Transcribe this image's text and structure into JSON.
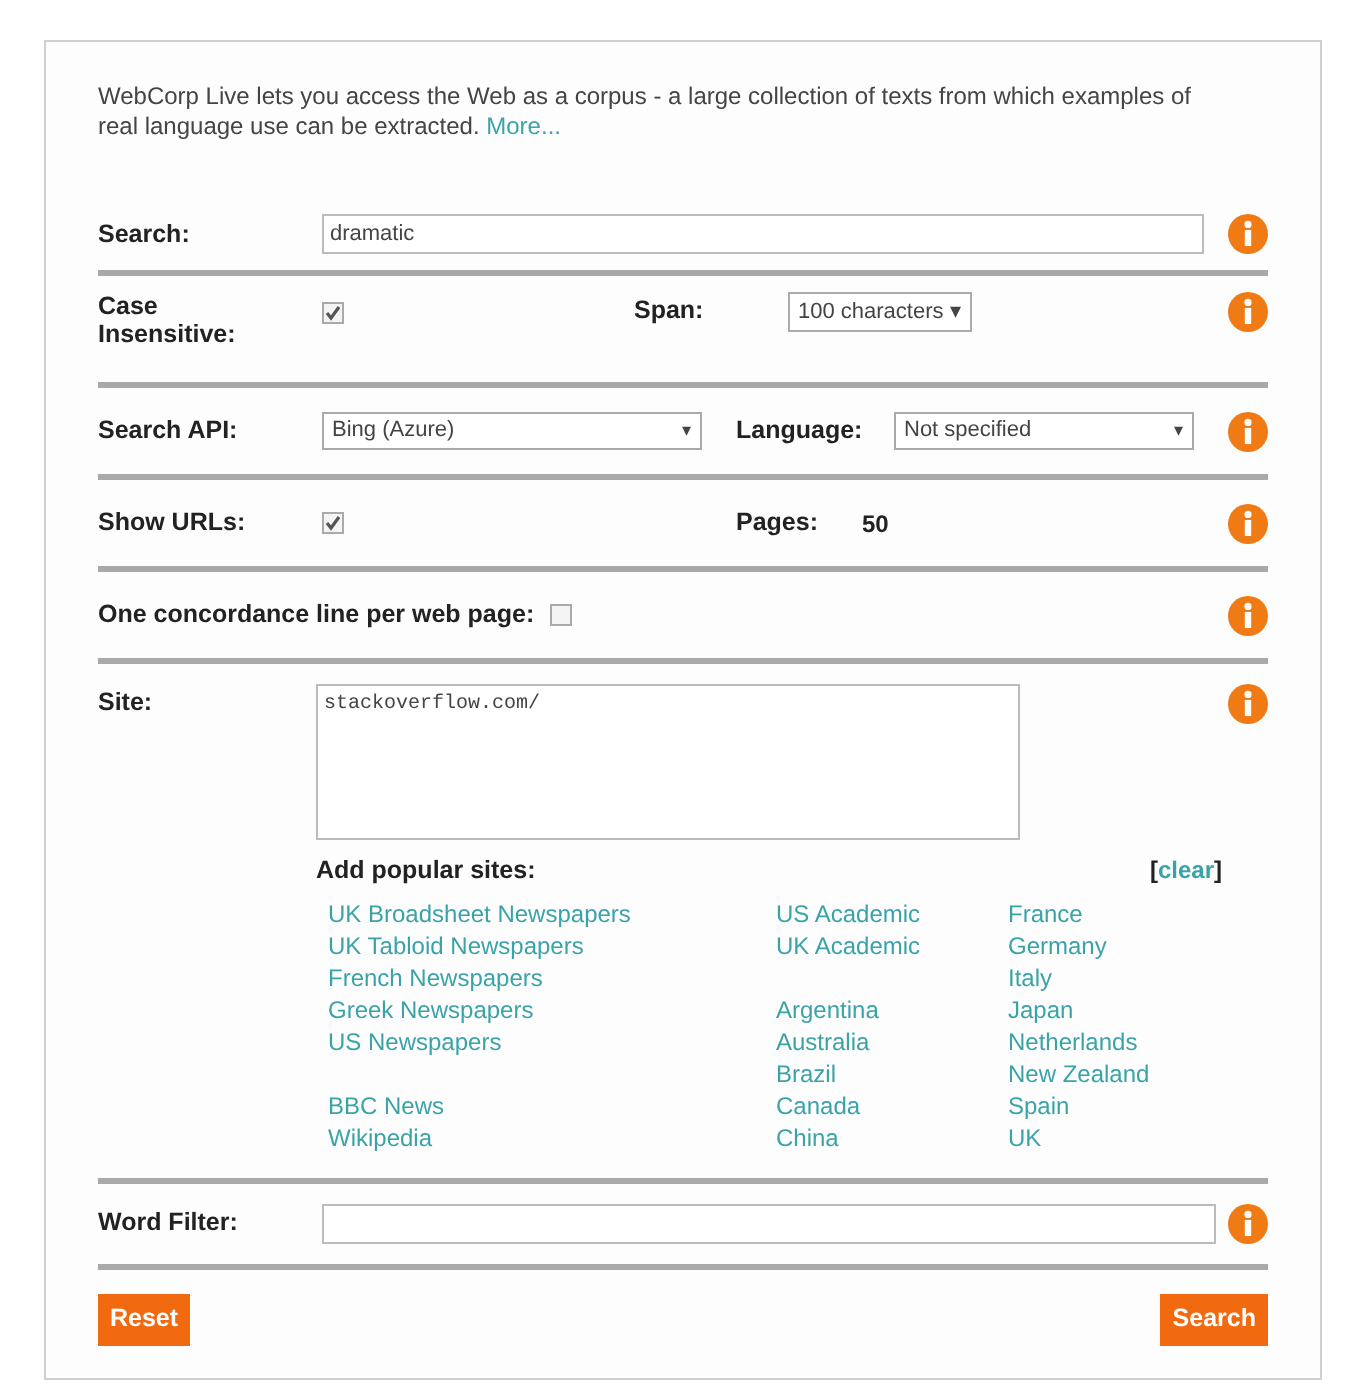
{
  "intro": {
    "text": "WebCorp Live lets you access the Web as a corpus - a large collection of texts from which examples of real language use can be extracted.",
    "link": "More..."
  },
  "search": {
    "label": "Search:",
    "value": "dramatic"
  },
  "case_insensitive": {
    "label": "Case Insensitive:",
    "checked": true
  },
  "span": {
    "label": "Span:",
    "value": "100 characters ▾"
  },
  "search_api": {
    "label": "Search API:",
    "value": "Bing (Azure)",
    "arrow": "▾"
  },
  "language": {
    "label": "Language:",
    "value": "Not specified",
    "arrow": "▾"
  },
  "show_urls": {
    "label": "Show URLs:",
    "checked": true
  },
  "pages": {
    "label": "Pages:",
    "value": "50"
  },
  "one_line_per_page": {
    "label": "One concordance line per web page:",
    "checked": false
  },
  "site": {
    "label": "Site:",
    "value": "stackoverflow.com/"
  },
  "popular_sites": {
    "title": "Add popular sites:",
    "clear_open": "[",
    "clear": "clear",
    "clear_close": "]",
    "columns": [
      [
        [
          "UK Broadsheet Newspapers",
          "UK Tabloid Newspapers",
          "French Newspapers",
          "Greek Newspapers",
          "US Newspapers"
        ],
        [
          "BBC News",
          "Wikipedia"
        ]
      ],
      [
        [
          "US Academic",
          "UK Academic"
        ],
        [
          "Argentina",
          "Australia",
          "Brazil",
          "Canada",
          "China"
        ]
      ],
      [
        [
          "France",
          "Germany",
          "Italy",
          "Japan",
          "Netherlands",
          "New Zealand",
          "Spain",
          "UK"
        ]
      ]
    ]
  },
  "word_filter": {
    "label": "Word Filter:"
  },
  "buttons": {
    "reset": "Reset",
    "search": "Search"
  }
}
